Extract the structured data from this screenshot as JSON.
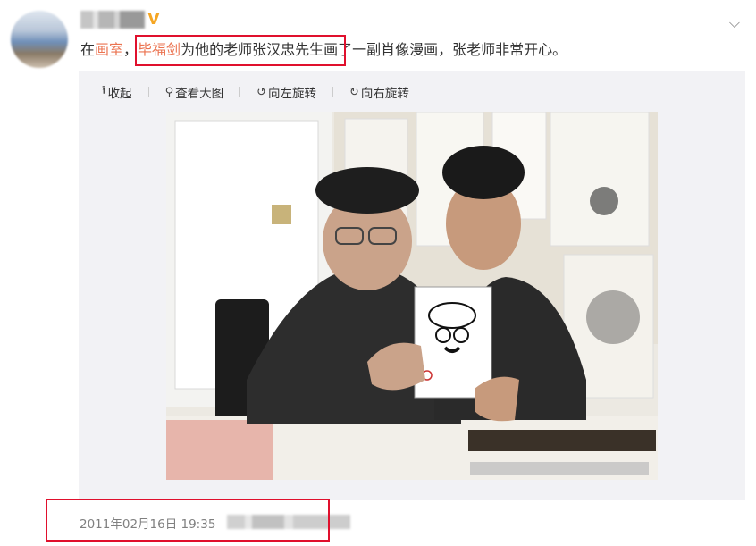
{
  "post": {
    "text_prefix": "在",
    "link1": "画室",
    "comma": "，",
    "link2": "毕福剑",
    "text_suffix": "为他的老师张汉忠先生画了一副肖像漫画，张老师非常开心。"
  },
  "toolbar": {
    "collapse": "收起",
    "view_large": "查看大图",
    "rotate_left": "向左旋转",
    "rotate_right": "向右旋转"
  },
  "meta": {
    "timestamp": "2011年02月16日 19:35"
  },
  "icons": {
    "verified": "verified-badge-icon",
    "expand": "chevron-down-icon",
    "collapse": "arrow-up-icon",
    "zoom": "magnifier-icon",
    "rotate_left": "rotate-left-icon",
    "rotate_right": "rotate-right-icon"
  },
  "colors": {
    "link": "#eb7350",
    "highlight_box": "#e0102d",
    "verified": "#f5a623",
    "muted": "#808080"
  }
}
